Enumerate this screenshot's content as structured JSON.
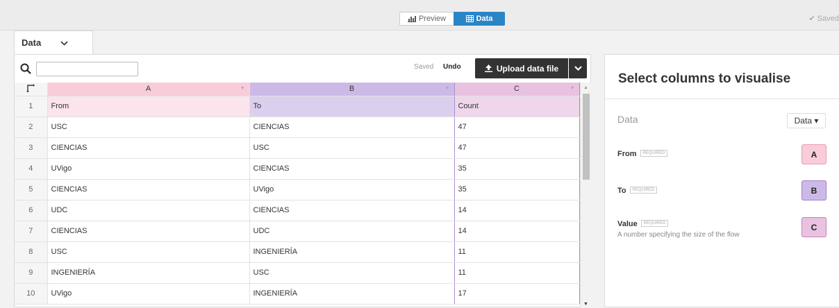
{
  "topbar": {
    "preview_label": "Preview",
    "data_label": "Data",
    "saved_label": "✔ Saved"
  },
  "sheet_tab": {
    "label": "Data"
  },
  "toolbar": {
    "search_value": "",
    "saved_label": "Saved",
    "undo_label": "Undo",
    "upload_label": "Upload data file"
  },
  "grid": {
    "column_headers": [
      "A",
      "B",
      "C"
    ],
    "rows": [
      {
        "n": "1",
        "a": "From",
        "b": "To",
        "c": "Count"
      },
      {
        "n": "2",
        "a": "USC",
        "b": "CIENCIAS",
        "c": "47"
      },
      {
        "n": "3",
        "a": "CIENCIAS",
        "b": "USC",
        "c": "47"
      },
      {
        "n": "4",
        "a": "UVigo",
        "b": "CIENCIAS",
        "c": "35"
      },
      {
        "n": "5",
        "a": "CIENCIAS",
        "b": "UVigo",
        "c": "35"
      },
      {
        "n": "6",
        "a": "UDC",
        "b": "CIENCIAS",
        "c": "14"
      },
      {
        "n": "7",
        "a": "CIENCIAS",
        "b": "UDC",
        "c": "14"
      },
      {
        "n": "8",
        "a": "USC",
        "b": "INGENIERÍA",
        "c": "11"
      },
      {
        "n": "9",
        "a": "INGENIERÍA",
        "b": "USC",
        "c": "11"
      },
      {
        "n": "10",
        "a": "UVigo",
        "b": "INGENIERÍA",
        "c": "17"
      }
    ]
  },
  "right_panel": {
    "title": "Select columns to visualise",
    "dataset_label": "Data",
    "dataset_value": "Data ▾",
    "required_tag": "REQUIRED",
    "bindings": [
      {
        "name": "From",
        "desc": "",
        "column": "A"
      },
      {
        "name": "To",
        "desc": "",
        "column": "B"
      },
      {
        "name": "Value",
        "desc": "A number specifying the size of the flow",
        "column": "C"
      }
    ]
  },
  "colors": {
    "col_a": "#f8cdd9",
    "col_b": "#cdb9e6",
    "col_c": "#e9c2e0",
    "accent": "#2a85c7",
    "button_dark": "#333333"
  }
}
